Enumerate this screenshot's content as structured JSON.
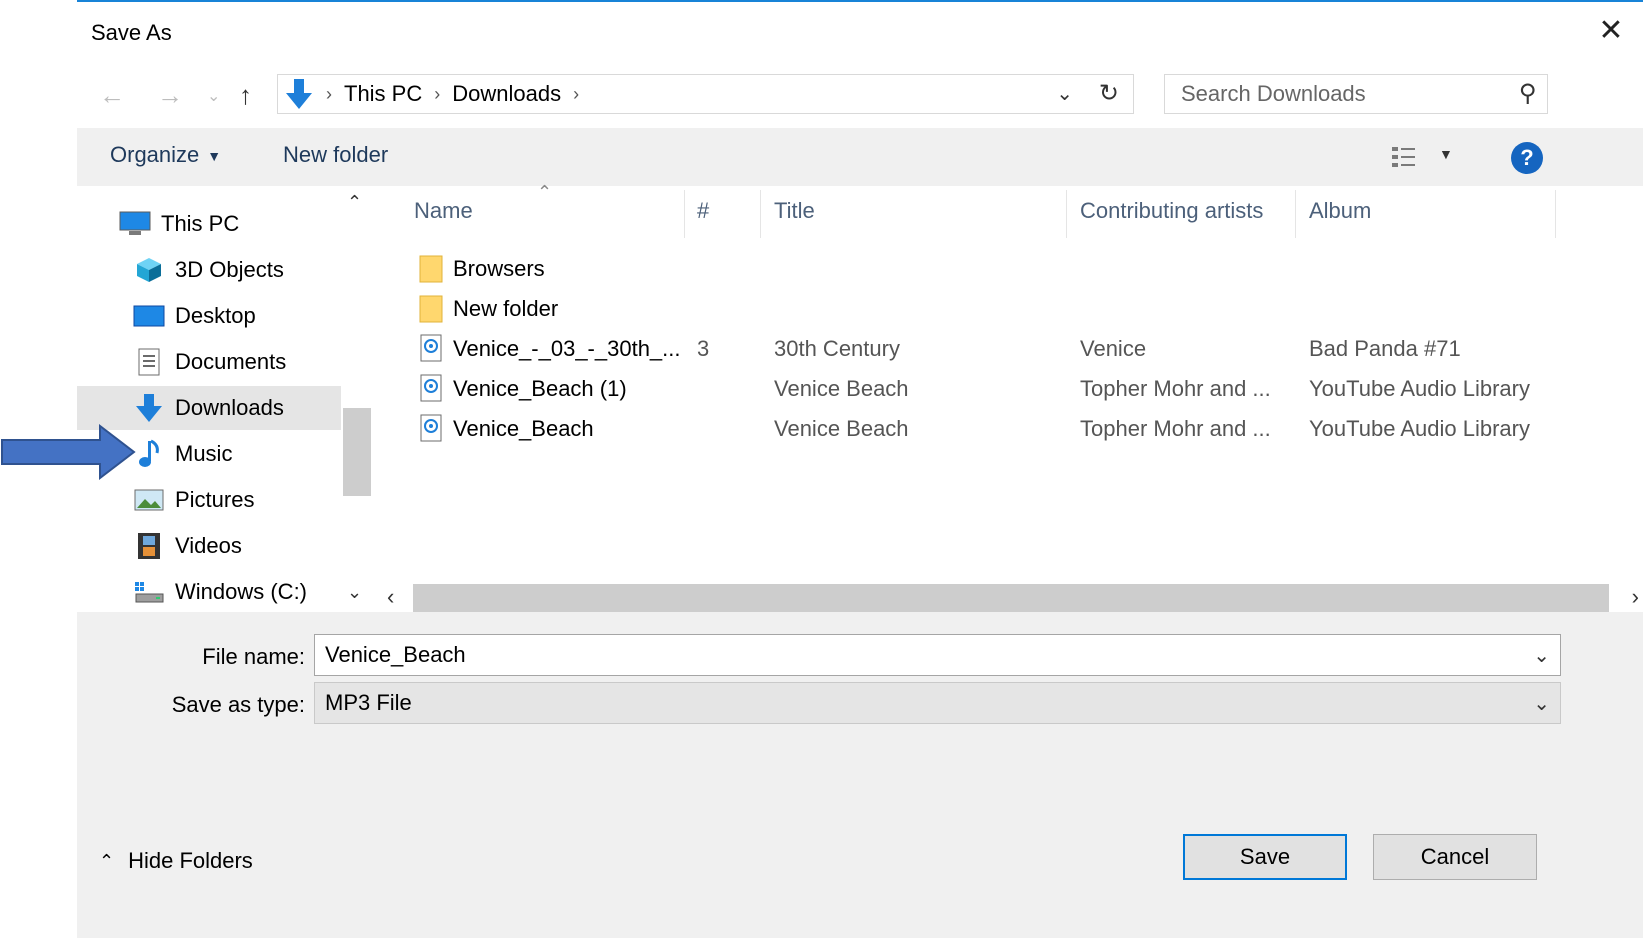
{
  "window": {
    "title": "Save As",
    "close_glyph": "✕"
  },
  "address": {
    "crumbs": [
      "This PC",
      "Downloads"
    ],
    "refresh_glyph": "↻"
  },
  "search": {
    "placeholder": "Search Downloads"
  },
  "toolbar": {
    "organize_label": "Organize",
    "new_folder_label": "New folder",
    "help_label": "?"
  },
  "nav_pane": {
    "items": [
      {
        "label": "This PC",
        "icon": "computer-icon",
        "selected": false
      },
      {
        "label": "3D Objects",
        "icon": "cube-icon",
        "selected": false
      },
      {
        "label": "Desktop",
        "icon": "desktop-icon",
        "selected": false
      },
      {
        "label": "Documents",
        "icon": "document-icon",
        "selected": false
      },
      {
        "label": "Downloads",
        "icon": "download-icon",
        "selected": true
      },
      {
        "label": "Music",
        "icon": "music-note-icon",
        "selected": false
      },
      {
        "label": "Pictures",
        "icon": "pictures-icon",
        "selected": false
      },
      {
        "label": "Videos",
        "icon": "film-icon",
        "selected": false
      },
      {
        "label": "Windows (C:)",
        "icon": "drive-icon",
        "selected": false
      }
    ]
  },
  "file_list": {
    "columns": [
      "Name",
      "#",
      "Title",
      "Contributing artists",
      "Album"
    ],
    "rows": [
      {
        "icon": "folder-icon",
        "name": "Browsers",
        "num": "",
        "title": "",
        "artists": "",
        "album": ""
      },
      {
        "icon": "folder-icon",
        "name": "New folder",
        "num": "",
        "title": "",
        "artists": "",
        "album": ""
      },
      {
        "icon": "audio-file-icon",
        "name": "Venice_-_03_-_30th_...",
        "num": "3",
        "title": "30th Century",
        "artists": "Venice",
        "album": "Bad Panda #71"
      },
      {
        "icon": "audio-file-icon",
        "name": "Venice_Beach (1)",
        "num": "",
        "title": "Venice Beach",
        "artists": "Topher Mohr and ...",
        "album": "YouTube Audio Library"
      },
      {
        "icon": "audio-file-icon",
        "name": "Venice_Beach",
        "num": "",
        "title": "Venice Beach",
        "artists": "Topher Mohr and ...",
        "album": "YouTube Audio Library"
      }
    ]
  },
  "form": {
    "file_name_label": "File name:",
    "file_name_value": "Venice_Beach",
    "save_type_label": "Save as type:",
    "save_type_value": "MP3 File"
  },
  "buttons": {
    "save": "Save",
    "cancel": "Cancel",
    "hide_folders": "Hide Folders"
  },
  "colors": {
    "accent": "#0078d7",
    "annotation_arrow": "#4472c4",
    "toolbar_bg": "#f0f0f0",
    "selected_bg": "#e5e5e5"
  }
}
